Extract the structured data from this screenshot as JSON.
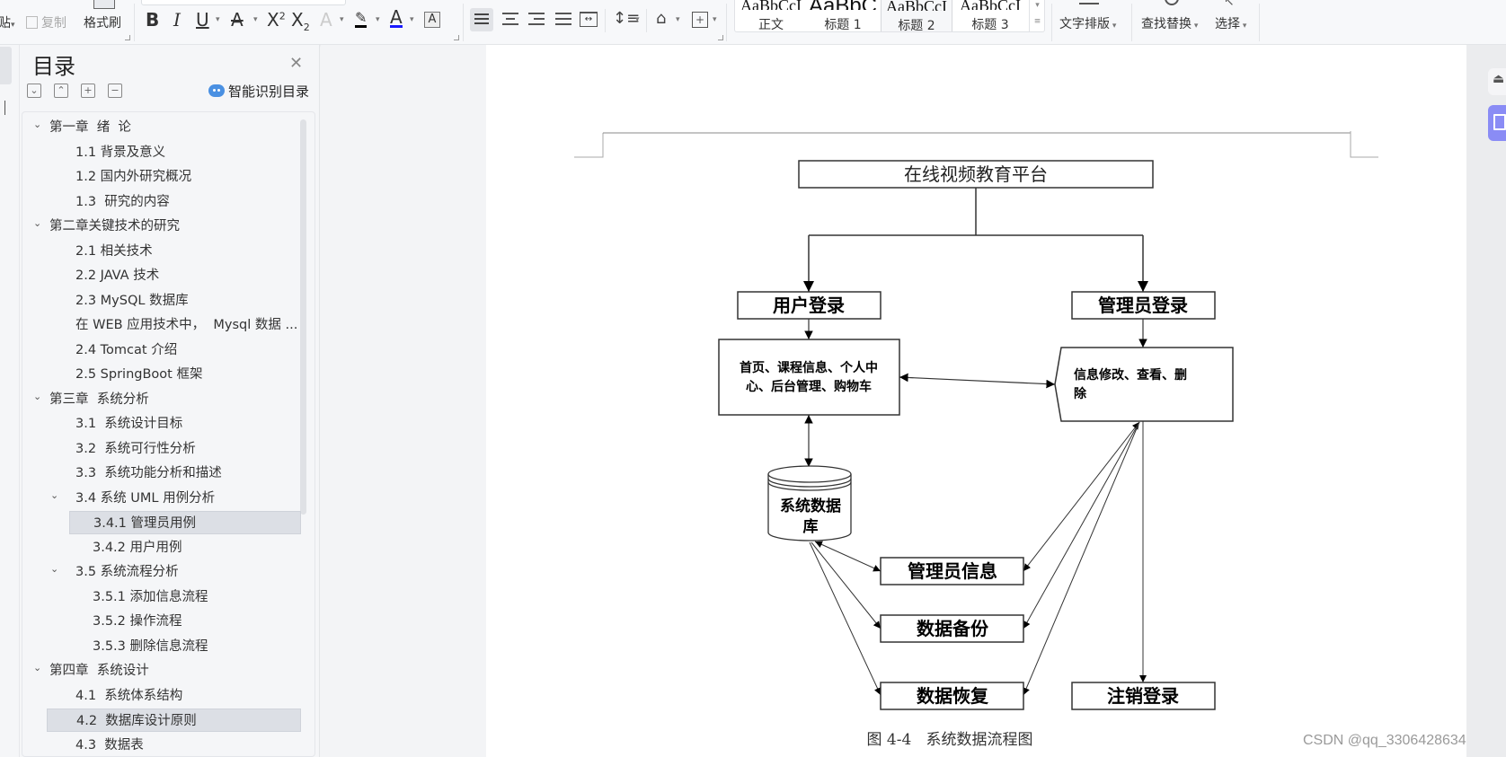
{
  "toolbar": {
    "clipboard": {
      "paste": "贴",
      "copy": "复制",
      "format_painter": "格式刷"
    },
    "font_buttons": [
      "B",
      "I",
      "U",
      "A",
      "X²",
      "X₂",
      "A",
      "highlighter",
      "A",
      "A"
    ],
    "styles": [
      {
        "preview": "AaBbCcI",
        "label": "正文"
      },
      {
        "preview": "AaBbC",
        "label": "标题 1"
      },
      {
        "preview": "AaBbCcI",
        "label": "标题 2"
      },
      {
        "preview": "AaBbCcI",
        "label": "标题 3"
      }
    ],
    "text_layout": "文字排版",
    "find_replace": "查找替换",
    "select": "选择"
  },
  "toc": {
    "title": "目录",
    "smart_label": "智能识别目录",
    "items": [
      {
        "label": "第一章  绪  论",
        "level": 0,
        "expanded": true
      },
      {
        "label": "1.1 背景及意义",
        "level": 1
      },
      {
        "label": "1.2 国内外研究概况",
        "level": 1
      },
      {
        "label": "1.3  研究的内容",
        "level": 1
      },
      {
        "label": "第二章关键技术的研究",
        "level": 0,
        "expanded": true
      },
      {
        "label": "2.1 相关技术",
        "level": 1
      },
      {
        "label": "2.2 JAVA 技术",
        "level": 1
      },
      {
        "label": "2.3 MySQL 数据库",
        "level": 1
      },
      {
        "label": "在 WEB 应用技术中，  Mysql 数据 ...",
        "level": 1
      },
      {
        "label": "2.4 Tomcat 介绍",
        "level": 1
      },
      {
        "label": "2.5 SpringBoot 框架",
        "level": 1
      },
      {
        "label": "第三章  系统分析",
        "level": 0,
        "expanded": true
      },
      {
        "label": "3.1  系统设计目标",
        "level": 1
      },
      {
        "label": "3.2  系统可行性分析",
        "level": 1
      },
      {
        "label": "3.3  系统功能分析和描述",
        "level": 1
      },
      {
        "label": "3.4 系统 UML 用例分析",
        "level": 1,
        "expanded": true
      },
      {
        "label": "3.4.1 管理员用例",
        "level": 2,
        "selected": true
      },
      {
        "label": "3.4.2 用户用例",
        "level": 2
      },
      {
        "label": "3.5 系统流程分析",
        "level": 1,
        "expanded": true
      },
      {
        "label": "3.5.1 添加信息流程",
        "level": 2
      },
      {
        "label": "3.5.2 操作流程",
        "level": 2
      },
      {
        "label": "3.5.3 删除信息流程",
        "level": 2
      },
      {
        "label": "第四章  系统设计",
        "level": 0,
        "expanded": true
      },
      {
        "label": "4.1  系统体系结构",
        "level": 1
      },
      {
        "label": "4.2  数据库设计原则",
        "level": 1,
        "highlighted": true
      },
      {
        "label": "4.3  数据表",
        "level": 1
      }
    ]
  },
  "diagram": {
    "platform": "在线视频教育平台",
    "user_login": "用户登录",
    "admin_login": "管理员登录",
    "user_functions_line1": "首页、课程信息、个人中",
    "user_functions_line2": "心、后台管理、购物车",
    "admin_functions_line1": "信息修改、查看、删",
    "admin_functions_line2": "除",
    "database_line1": "系统数据",
    "database_line2": "库",
    "admin_info": "管理员信息",
    "data_backup": "数据备份",
    "data_restore": "数据恢复",
    "logout": "注销登录",
    "caption": "图 4-4   系统数据流程图"
  },
  "watermark": "CSDN @qq_3306428634"
}
